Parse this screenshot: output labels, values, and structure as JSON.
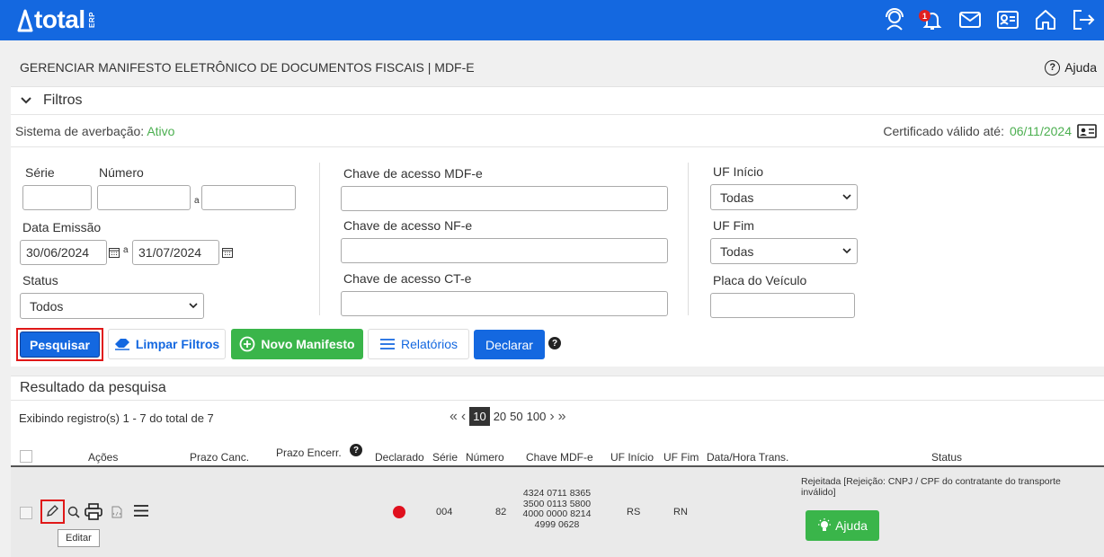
{
  "app": {
    "logo_text": "total",
    "logo_sub": "ERP",
    "notification_count": "1"
  },
  "page": {
    "title": "GERENCIAR MANIFESTO ELETRÔNICO DE DOCUMENTOS FISCAIS | MDF-E",
    "help_label": "Ajuda"
  },
  "filters": {
    "header": "Filtros",
    "averbacao_label": "Sistema de averbação:",
    "averbacao_value": "Ativo",
    "cert_label": "Certificado válido até:",
    "cert_value": "06/11/2024",
    "serie_label": "Série",
    "numero_label": "Número",
    "range_sep": "a",
    "data_emissao_label": "Data Emissão",
    "data_inicio": "30/06/2024",
    "data_fim": "31/07/2024",
    "status_label": "Status",
    "status_value": "Todos",
    "chave_mdfe_label": "Chave de acesso MDF-e",
    "chave_nfe_label": "Chave de acesso NF-e",
    "chave_cte_label": "Chave de acesso CT-e",
    "uf_inicio_label": "UF Início",
    "uf_inicio_value": "Todas",
    "uf_fim_label": "UF Fim",
    "uf_fim_value": "Todas",
    "placa_label": "Placa do Veículo"
  },
  "actions": {
    "pesquisar": "Pesquisar",
    "limpar": "Limpar Filtros",
    "novo": "Novo Manifesto",
    "relatorios": "Relatórios",
    "declarar": "Declarar"
  },
  "results": {
    "header": "Resultado da pesquisa",
    "summary": "Exibindo registro(s) 1 - 7 do total de 7",
    "page_sizes": [
      "10",
      "20",
      "50",
      "100"
    ],
    "columns": {
      "acoes": "Ações",
      "prazo_canc": "Prazo Canc.",
      "prazo_encerr": "Prazo Encerr.",
      "declarado": "Declarado",
      "serie": "Série",
      "numero": "Número",
      "chave": "Chave MDF-e",
      "uf_inicio": "UF Início",
      "uf_fim": "UF Fim",
      "data_hora": "Data/Hora Trans.",
      "status": "Status"
    },
    "row": {
      "serie": "004",
      "numero": "82",
      "chave_lines": [
        "4324 0711 8365",
        "3500 0113 5800",
        "4000 0000 8214",
        "4999 0628"
      ],
      "uf_inicio": "RS",
      "uf_fim": "RN",
      "status_text": "Rejeitada [Rejeição: CNPJ / CPF do contratante do transporte inválido]",
      "help_button": "Ajuda",
      "declarado_color": "#e0101e"
    },
    "tooltip": "Editar"
  }
}
